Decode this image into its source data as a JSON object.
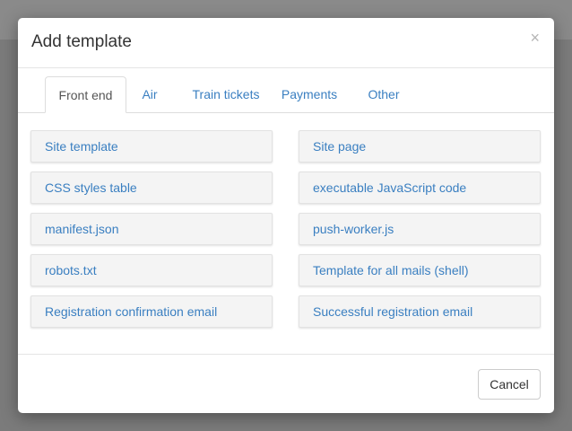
{
  "dialog": {
    "title": "Add template",
    "close_glyph": "×",
    "close_icon": "close-icon"
  },
  "tabs": [
    {
      "label": "Front end",
      "active": true
    },
    {
      "label": "Air",
      "active": false
    },
    {
      "label": "Train tickets",
      "active": false
    },
    {
      "label": "Payments",
      "active": false
    },
    {
      "label": "Other",
      "active": false
    }
  ],
  "templates": [
    {
      "label": "Site template"
    },
    {
      "label": "Site page"
    },
    {
      "label": "CSS styles table"
    },
    {
      "label": "executable JavaScript code"
    },
    {
      "label": "manifest.json"
    },
    {
      "label": "push-worker.js"
    },
    {
      "label": "robots.txt"
    },
    {
      "label": "Template for all mails (shell)"
    },
    {
      "label": "Registration confirmation email"
    },
    {
      "label": "Successful registration email"
    }
  ],
  "footer": {
    "cancel_label": "Cancel"
  },
  "colors": {
    "link": "#3a7fc1",
    "tile_bg": "#f4f4f4",
    "backdrop": "#7b7b7b"
  }
}
